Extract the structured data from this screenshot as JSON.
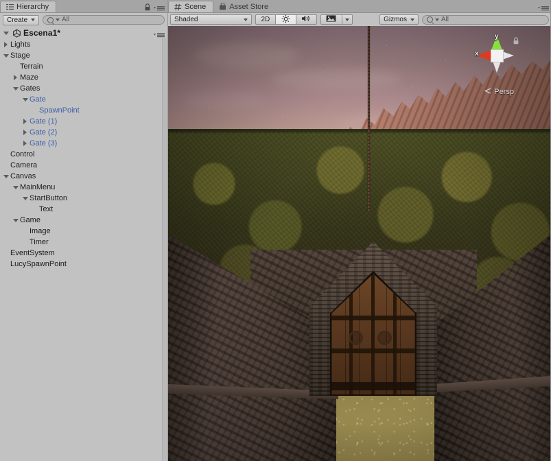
{
  "hierarchy": {
    "tab_label": "Hierarchy",
    "tab_icon": "hierarchy-icon",
    "lock_icon": "lock-icon",
    "menu_icon": "panel-menu-icon",
    "create_label": "Create",
    "search_placeholder": "All",
    "search_value": "All",
    "scene_name": "Escena1*",
    "scene_icon": "unity-scene-icon",
    "items": [
      {
        "label": "Lights",
        "depth": 1,
        "toggle": "closed",
        "prefab": false
      },
      {
        "label": "Stage",
        "depth": 1,
        "toggle": "open",
        "prefab": false
      },
      {
        "label": "Terrain",
        "depth": 2,
        "toggle": "none",
        "prefab": false
      },
      {
        "label": "Maze",
        "depth": 2,
        "toggle": "closed",
        "prefab": false
      },
      {
        "label": "Gates",
        "depth": 2,
        "toggle": "open",
        "prefab": false
      },
      {
        "label": "Gate",
        "depth": 3,
        "toggle": "open",
        "prefab": true
      },
      {
        "label": "SpawnPoint",
        "depth": 4,
        "toggle": "none",
        "prefab": true
      },
      {
        "label": "Gate (1)",
        "depth": 3,
        "toggle": "closed",
        "prefab": true
      },
      {
        "label": "Gate (2)",
        "depth": 3,
        "toggle": "closed",
        "prefab": true
      },
      {
        "label": "Gate (3)",
        "depth": 3,
        "toggle": "closed",
        "prefab": true
      },
      {
        "label": "Control",
        "depth": 1,
        "toggle": "none",
        "prefab": false
      },
      {
        "label": "Camera",
        "depth": 1,
        "toggle": "none",
        "prefab": false
      },
      {
        "label": "Canvas",
        "depth": 1,
        "toggle": "open",
        "prefab": false
      },
      {
        "label": "MainMenu",
        "depth": 2,
        "toggle": "open",
        "prefab": false
      },
      {
        "label": "StartButton",
        "depth": 3,
        "toggle": "open",
        "prefab": false
      },
      {
        "label": "Text",
        "depth": 4,
        "toggle": "none",
        "prefab": false
      },
      {
        "label": "Game",
        "depth": 2,
        "toggle": "open",
        "prefab": false
      },
      {
        "label": "Image",
        "depth": 3,
        "toggle": "none",
        "prefab": false
      },
      {
        "label": "Timer",
        "depth": 3,
        "toggle": "none",
        "prefab": false
      },
      {
        "label": "EventSystem",
        "depth": 1,
        "toggle": "none",
        "prefab": false
      },
      {
        "label": "LucySpawnPoint",
        "depth": 1,
        "toggle": "none",
        "prefab": false
      }
    ]
  },
  "scene_panel": {
    "tabs": [
      {
        "label": "Scene",
        "icon": "grid-icon",
        "active": true
      },
      {
        "label": "Asset Store",
        "icon": "store-bag-icon",
        "active": false
      }
    ],
    "menu_icon": "panel-menu-icon",
    "toolbar": {
      "draw_mode": "Shaded",
      "toggle_2d": "2D",
      "lighting_icon": "sun-icon",
      "lighting_on": true,
      "audio_icon": "speaker-icon",
      "effects_icon": "image-icon",
      "effects_dropdown_icon": "chevron-down-icon",
      "gizmos_label": "Gizmos",
      "search_placeholder": "All",
      "search_value": "All"
    },
    "viewport": {
      "gizmo": {
        "axis_y_label": "y",
        "axis_x_label": "x",
        "projection_label": "Persp",
        "projection_arrow": "chevron-left-icon",
        "lock_icon": "lock-icon",
        "color_x": "#e03a1e",
        "color_y": "#86e03e",
        "color_z": "#e6e6e6"
      },
      "colors": {
        "sky": "#bb969a",
        "mountain": "#b9806f",
        "foliage": "#4e5226",
        "ground": "#8e8049",
        "stone_wall": "#51413a",
        "door_wood": "#59381f"
      }
    }
  }
}
